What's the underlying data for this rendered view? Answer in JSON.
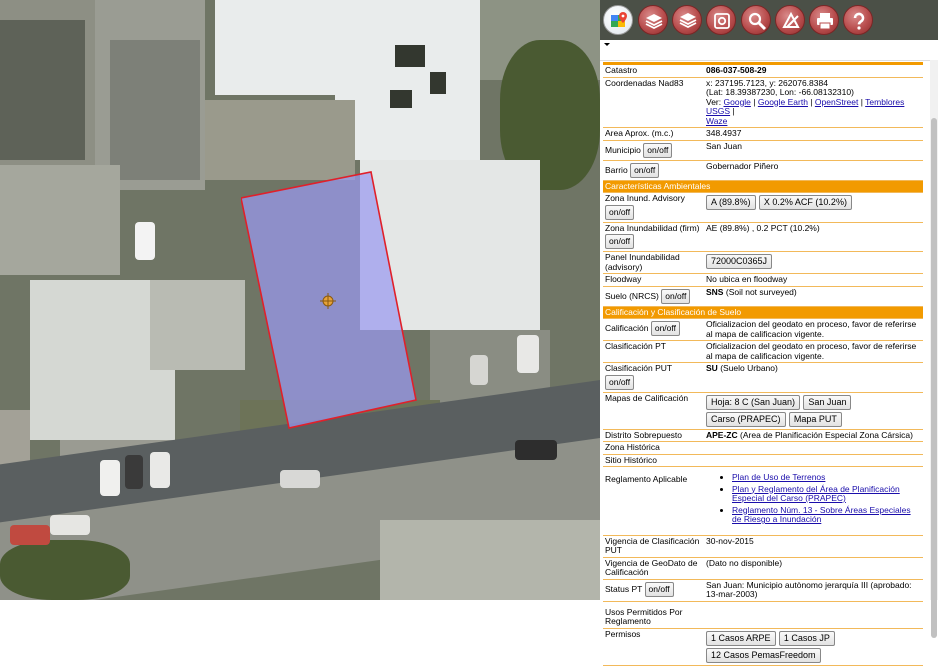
{
  "toolbar": {
    "buttons": [
      {
        "name": "google-maps",
        "icon": "map-pin-icon"
      },
      {
        "name": "layers-base",
        "icon": "layers-icon"
      },
      {
        "name": "layers-overlay",
        "icon": "layers-stack-icon"
      },
      {
        "name": "settings",
        "icon": "gear-icon"
      },
      {
        "name": "search",
        "icon": "search-icon"
      },
      {
        "name": "measure",
        "icon": "ruler-icon"
      },
      {
        "name": "print",
        "icon": "printer-icon"
      },
      {
        "name": "help",
        "icon": "question-icon"
      }
    ]
  },
  "info": {
    "catastro": {
      "label": "Catastro",
      "value": "086-037-508-29"
    },
    "coords": {
      "label": "Coordenadas Nad83",
      "xy": "x: 237195.7123, y: 262076.8384",
      "latlon": "(Lat: 18.39387230, Lon: -66.08132310)",
      "ver": "Ver:",
      "links": [
        "Google",
        "Google Earth",
        "OpenStreet",
        "Temblores USGS",
        "Waze"
      ]
    },
    "area": {
      "label": "Area Aprox. (m.c.)",
      "value": "348.4937"
    },
    "municipio": {
      "label": "Municipio",
      "button": "on/off",
      "value": "San Juan"
    },
    "barrio": {
      "label": "Barrio",
      "button": "on/off",
      "value": "Gobernador Piñero"
    },
    "sec_ambientales": "Características Ambientales",
    "zona_advisory": {
      "label": "Zona Inund. Advisory",
      "buttons": [
        "A (89.8%)",
        "X 0.2% ACF (10.2%)"
      ],
      "toggle": "on/off"
    },
    "zona_firm": {
      "label": "Zona Inundabilidad (firm)",
      "toggle": "on/off",
      "value": "AE (89.8%) , 0.2 PCT (10.2%)"
    },
    "panel_inund": {
      "label": "Panel Inundabilidad (advisory)",
      "button": "72000C0365J"
    },
    "floodway": {
      "label": "Floodway",
      "value": "No ubica en floodway"
    },
    "suelo": {
      "label": "Suelo (NRCS)",
      "button": "on/off",
      "code": "SNS",
      "value": "(Soil not surveyed)"
    },
    "sec_calificacion": "Calificación y Clasificación de Suelo",
    "calificacion": {
      "label": "Calificación",
      "button": "on/off",
      "value": "Oficializacion del geodato en proceso, favor de referirse al mapa de calificacion vigente."
    },
    "clasificacion_pt": {
      "label": "Clasificación PT",
      "value": "Oficializacion del geodato en proceso, favor de referirse al mapa de calificacion vigente."
    },
    "clasificacion_put": {
      "label": "Clasificación PUT",
      "button": "on/off",
      "code": "SU",
      "value": "(Suelo Urbano)"
    },
    "mapas": {
      "label": "Mapas de Calificación",
      "buttons": [
        "Hoja: 8 C (San Juan)",
        "San Juan",
        "Carso (PRAPEC)",
        "Mapa PUT"
      ]
    },
    "distrito": {
      "label": "Distrito Sobrepuesto",
      "code": "APE-ZC",
      "value": "(Area de Planificación Especial Zona Cársica)"
    },
    "zona_historica": {
      "label": "Zona Histórica",
      "value": ""
    },
    "sitio_historico": {
      "label": "Sitio Histórico",
      "value": ""
    },
    "reglamento": {
      "label": "Reglamento Aplicable",
      "links": [
        "Plan de Uso de Terrenos",
        "Plan y Reglamento del Área de Planificación Especial del Carso (PRAPEC)",
        "Reglamento Núm. 13 - Sobre Áreas Especiales de Riesgo a Inundación"
      ]
    },
    "vigencia_put": {
      "label": "Vigencia de Clasificación PUT",
      "value": "30-nov-2015"
    },
    "vigencia_geo": {
      "label": "Vigencia de GeoDato de Calificación",
      "value": "(Dato no disponible)"
    },
    "status_pt": {
      "label": "Status PT",
      "button": "on/off",
      "value": "San Juan: Municipio autònomo jerarquía III (aprobado: 13-mar-2003)"
    },
    "usos": {
      "label": "Usos Permitidos Por Reglamento",
      "value": ""
    },
    "permisos": {
      "label": "Permisos",
      "buttons": [
        "1 Casos ARPE",
        "1 Casos JP",
        "12 Casos PemasFreedom"
      ]
    }
  },
  "colors": {
    "section_bg": "#f29a00",
    "parcel_outline": "#e0202a",
    "parcel_fill": "#9a9af0",
    "toolbar_button": "#b84d4d"
  }
}
